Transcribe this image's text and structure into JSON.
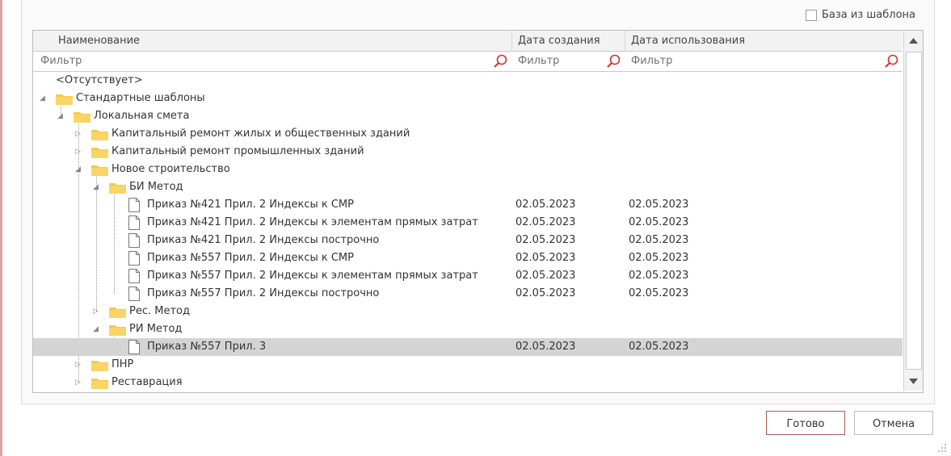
{
  "options": {
    "base_from_template_label": "База из шаблона"
  },
  "grid": {
    "columns": [
      "Наименование",
      "Дата создания",
      "Дата использования"
    ],
    "filters": {
      "placeholder": "Фильтр"
    },
    "rows": [
      {
        "label": "<Отсутствует>"
      },
      {
        "label": "Стандартные шаблоны"
      },
      {
        "label": "Локальная смета"
      },
      {
        "label": "Капитальный ремонт жилых и общественных зданий"
      },
      {
        "label": "Капитальный ремонт промышленных зданий"
      },
      {
        "label": "Новое строительство"
      },
      {
        "label": "БИ Метод"
      },
      {
        "label": "Приказ №421 Прил. 2 Индексы к СМР",
        "created": "02.05.2023",
        "used": "02.05.2023"
      },
      {
        "label": "Приказ №421 Прил. 2 Индексы к элементам прямых затрат",
        "created": "02.05.2023",
        "used": "02.05.2023"
      },
      {
        "label": "Приказ №421 Прил. 2 Индексы построчно",
        "created": "02.05.2023",
        "used": "02.05.2023"
      },
      {
        "label": "Приказ №557 Прил. 2 Индексы к СМР",
        "created": "02.05.2023",
        "used": "02.05.2023"
      },
      {
        "label": "Приказ №557 Прил. 2 Индексы к элементам прямых затрат",
        "created": "02.05.2023",
        "used": "02.05.2023"
      },
      {
        "label": "Приказ №557 Прил. 2 Индексы построчно",
        "created": "02.05.2023",
        "used": "02.05.2023"
      },
      {
        "label": "Рес. Метод"
      },
      {
        "label": "РИ Метод"
      },
      {
        "label": "Приказ №557 Прил. 3",
        "created": "02.05.2023",
        "used": "02.05.2023",
        "selected": true
      },
      {
        "label": "ПНР"
      },
      {
        "label": "Реставрация"
      }
    ]
  },
  "buttons": {
    "ok": "Готово",
    "cancel": "Отмена"
  },
  "colors": {
    "folder": "#f7c948",
    "selected_row": "#d4d4d4",
    "search_icon": "#d32f2f",
    "ok_border": "#b45757"
  },
  "icons": [
    "search-icon",
    "folder-icon",
    "document-icon",
    "scroll-up-icon",
    "scroll-down-icon",
    "resize-grip-icon"
  ]
}
